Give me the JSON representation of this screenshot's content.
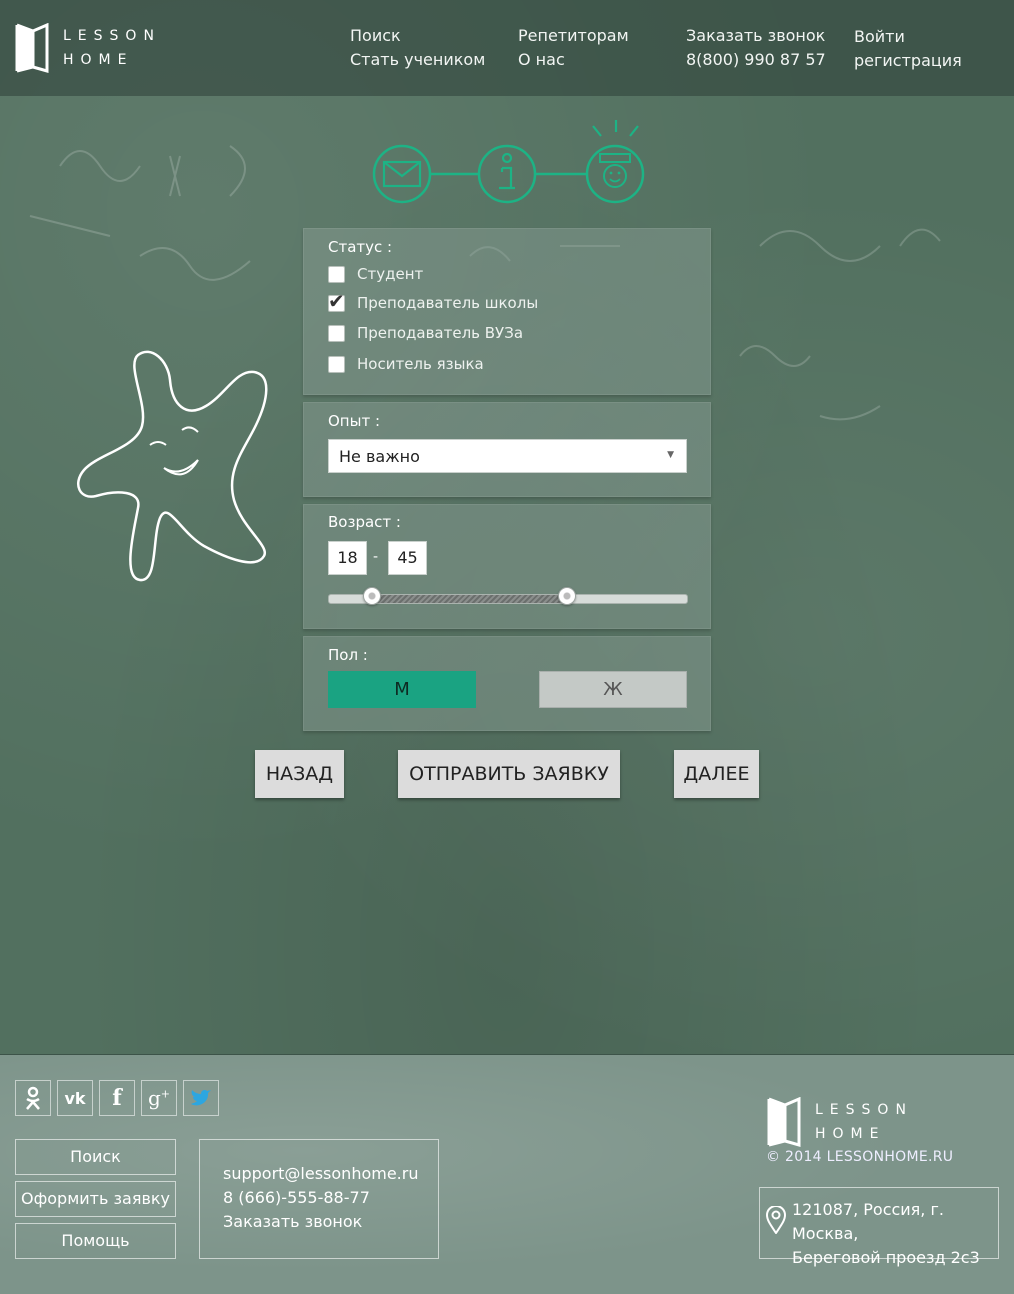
{
  "brand": {
    "line1": "LESSON",
    "line2": "HOME"
  },
  "nav": {
    "col1": [
      "Поиск",
      "Стать учеником"
    ],
    "col2": [
      "Репетиторам",
      "О нас"
    ],
    "col3": [
      "Заказать звонок",
      "8(800) 990 87 57"
    ],
    "col4": [
      "Войти",
      "регистрация"
    ]
  },
  "steps": {
    "icons": [
      "envelope-icon",
      "info-icon",
      "smiley-icon"
    ],
    "accent": "#1db385",
    "active_step": 3
  },
  "form": {
    "status": {
      "label": "Статус :",
      "options": [
        {
          "label": "Студент",
          "checked": false
        },
        {
          "label": "Преподаватель школы",
          "checked": true
        },
        {
          "label": "Преподаватель ВУЗа",
          "checked": false
        },
        {
          "label": "Носитель языка",
          "checked": false
        }
      ]
    },
    "experience": {
      "label": "Опыт :",
      "value": "Не важно"
    },
    "age": {
      "label": "Возраст :",
      "min": "18",
      "dash": "-",
      "max": "45"
    },
    "gender": {
      "label": "Пол :",
      "male": "М",
      "female": "Ж",
      "selected": "М",
      "selected_color": "#1aa382"
    }
  },
  "actions": {
    "back": "НАЗАД",
    "submit": "ОТПРАВИТЬ ЗАЯВКУ",
    "next": "ДАЛЕЕ"
  },
  "footer": {
    "social": [
      "odnoklassniki-icon",
      "vk-icon",
      "facebook-icon",
      "google-plus-icon",
      "twitter-icon"
    ],
    "links": [
      "Поиск",
      "Оформить заявку",
      "Помощь"
    ],
    "contacts": {
      "email": "support@lessonhome.ru",
      "phone": "8 (666)-555-88-77",
      "callback": "Заказать звонок"
    },
    "brand": {
      "line1": "LESSON",
      "line2": "HOME"
    },
    "copyright": "© 2014 LESSONHOME.RU",
    "address": {
      "line1": "121087, Россия, г. Москва,",
      "line2": "Береговой проезд 2с3"
    }
  }
}
